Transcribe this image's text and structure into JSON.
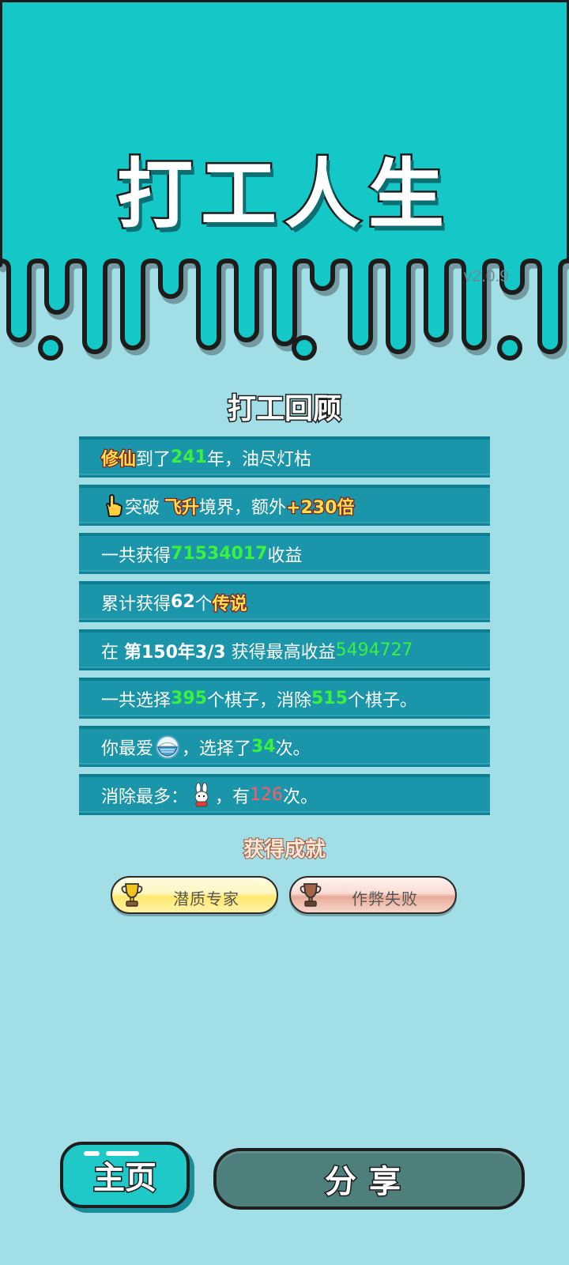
{
  "app": {
    "title": "打工人生",
    "version": "v2.0.9"
  },
  "review": {
    "title": "打工回顾",
    "rows": [
      {
        "parts": [
          "修仙",
          "到了",
          "241",
          "年，油尽灯枯"
        ]
      },
      {
        "parts": [
          "突破",
          "飞升",
          "境界，额外",
          "+230倍"
        ]
      },
      {
        "parts": [
          "一共获得",
          "71534017",
          "收益"
        ]
      },
      {
        "parts": [
          "累计获得",
          "62",
          "个",
          "传说"
        ]
      },
      {
        "parts": [
          "在 ",
          "第150年3/3",
          " 获得最高收益",
          "5494727"
        ]
      },
      {
        "parts": [
          "一共选择",
          "395",
          "个棋子，消除",
          "515",
          "个棋子。"
        ]
      },
      {
        "parts": [
          "你最爱",
          "，选择了",
          "34",
          "次。"
        ]
      },
      {
        "parts": [
          "消除最多：",
          "，有",
          "126",
          "次。"
        ]
      }
    ]
  },
  "achievements": {
    "title": "获得成就",
    "items": [
      {
        "label": "潜质专家",
        "tier": "gold"
      },
      {
        "label": "作弊失败",
        "tier": "bronze"
      }
    ]
  },
  "buttons": {
    "home": "主页",
    "share": "分享"
  },
  "icons": {
    "pointer": "pointing-hand-icon",
    "favorite": "rice-bowl-icon",
    "most_eliminated": "rabbit-icon",
    "trophy": "trophy-icon"
  },
  "colors": {
    "header_bg": "#15c8c8",
    "page_bg": "#a2dee6",
    "row_bg": "#1a95aa",
    "highlight_green": "#39f23f",
    "highlight_yellow": "#ffe14a",
    "highlight_red": "#ff5a6a",
    "home_button": "#1ec9c8",
    "share_button": "#4d7f7c"
  }
}
